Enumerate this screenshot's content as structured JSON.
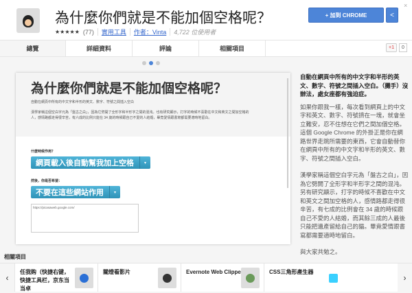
{
  "header": {
    "title": "為什麼你們就是不能加個空格呢？",
    "rating_stars": "★★★★★",
    "rating_count": "(77)",
    "category": "實用工具",
    "author": "作者：Vinta",
    "users": "4,722 位使用者",
    "add_button": "+ 加到 CHROME",
    "share_icon": "share-icon",
    "close": "×"
  },
  "tabs": [
    {
      "label": "總覽",
      "active": true
    },
    {
      "label": "詳細資料"
    },
    {
      "label": "評論"
    },
    {
      "label": "相關項目"
    }
  ],
  "gplus": {
    "label": "+1",
    "count": "0"
  },
  "screenshot": {
    "title": "為什麼你們就是不能加個空格呢？",
    "subtitle": "自動在網頁中所有的中文字和半形的英文、數字、符號之間插入空白",
    "para": "漢學家稱這個空白字元為「盤古之白」，因為它劈開了全形字和半形字之間的混沌。也有研究顯示，打字的時候不喜歡在中文和英文之間加空格的人，感情路都走得很辛苦，有六成的比例只能在 34 歲的時候跟自己不愛的人結婚，畢竟愛情跟書寫都需要適時地留白。",
    "q1": "什麼時候作用？",
    "btn1": "網頁載入後自動幫我加上空格",
    "q2": "然後，你是否希望：",
    "btn2": "不要在這些網站作用",
    "textarea": "https://picasaweb.google.com/"
  },
  "description": {
    "lead": "自動在網頁中所有的中文字和半形的英文、數字、符號之間插入空白。（攤手）沒辦法，處女座都有強迫症。",
    "p1": "如果你跟我一樣，每次看到網頁上的中文字和英文、數字、符號擠在一塊，就會坐立難安，忍不住想在它們之間加個空格。這個 Google Chrome 的外掛正是你在網路世界走跳所需要的東西，它會自動替你在網頁中所有的中文字和半形的英文、數字、符號之間插入空白。",
    "p2": "漢學家稱這個空白字元為「盤古之白」，因為它劈開了全形字和半形字之間的混沌。另有研究顯示，打字的時候不喜歡在中文和英文之間加空格的人，感情路都走得很辛苦，有七成的比例會在 34 歲的時候跟自己不愛的人結婚，而其餘三成的人最後只能把遺產留給自己的貓。畢竟愛情跟書寫都需要適時地留白。",
    "p3": "與大家共勉之。"
  },
  "related": {
    "heading": "相關項目",
    "items": [
      {
        "name": "任我购（快捷右键，快捷工具栏，京东当当卓",
        "color": "#2a6fd6"
      },
      {
        "name": "關燈看影片",
        "color": "#333333"
      },
      {
        "name": "Evernote Web Clipper",
        "color": "#6a9a5a"
      },
      {
        "name": "CSS三角形產生器",
        "color": "#3ad0ff"
      }
    ]
  }
}
